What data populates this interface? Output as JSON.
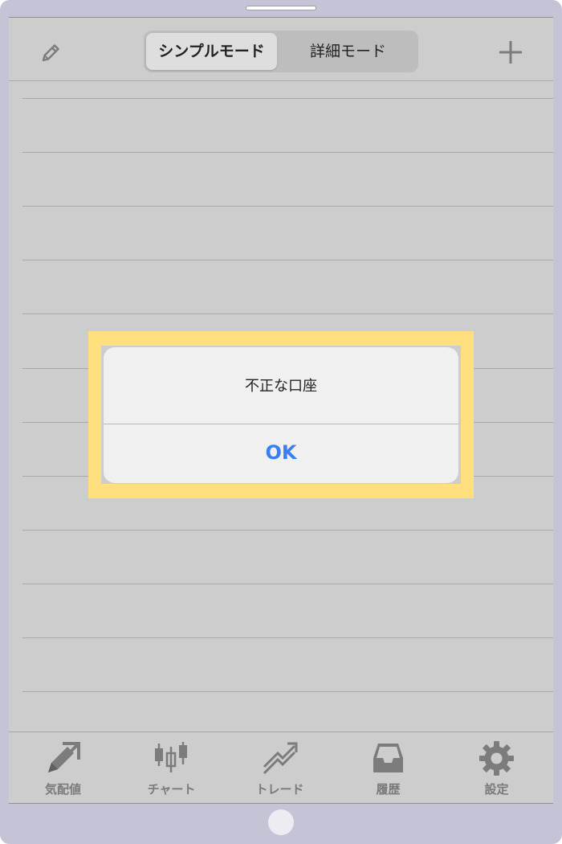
{
  "navbar": {
    "segments": [
      {
        "label": "シンプルモード",
        "selected": true
      },
      {
        "label": "詳細モード",
        "selected": false
      }
    ],
    "left_icon": "pencil-edit-icon",
    "right_icon": "plus-icon"
  },
  "dialog": {
    "message": "不正な口座",
    "button_label": "OK",
    "button_color": "#3a7ff0"
  },
  "highlight_color": "#ffdf7e",
  "tabbar": {
    "items": [
      {
        "label": "気配値",
        "icon": "quote-arrow-icon"
      },
      {
        "label": "チャート",
        "icon": "candlestick-chart-icon"
      },
      {
        "label": "トレード",
        "icon": "trade-arrow-icon"
      },
      {
        "label": "履歴",
        "icon": "inbox-tray-icon"
      },
      {
        "label": "設定",
        "icon": "gear-icon"
      }
    ]
  }
}
